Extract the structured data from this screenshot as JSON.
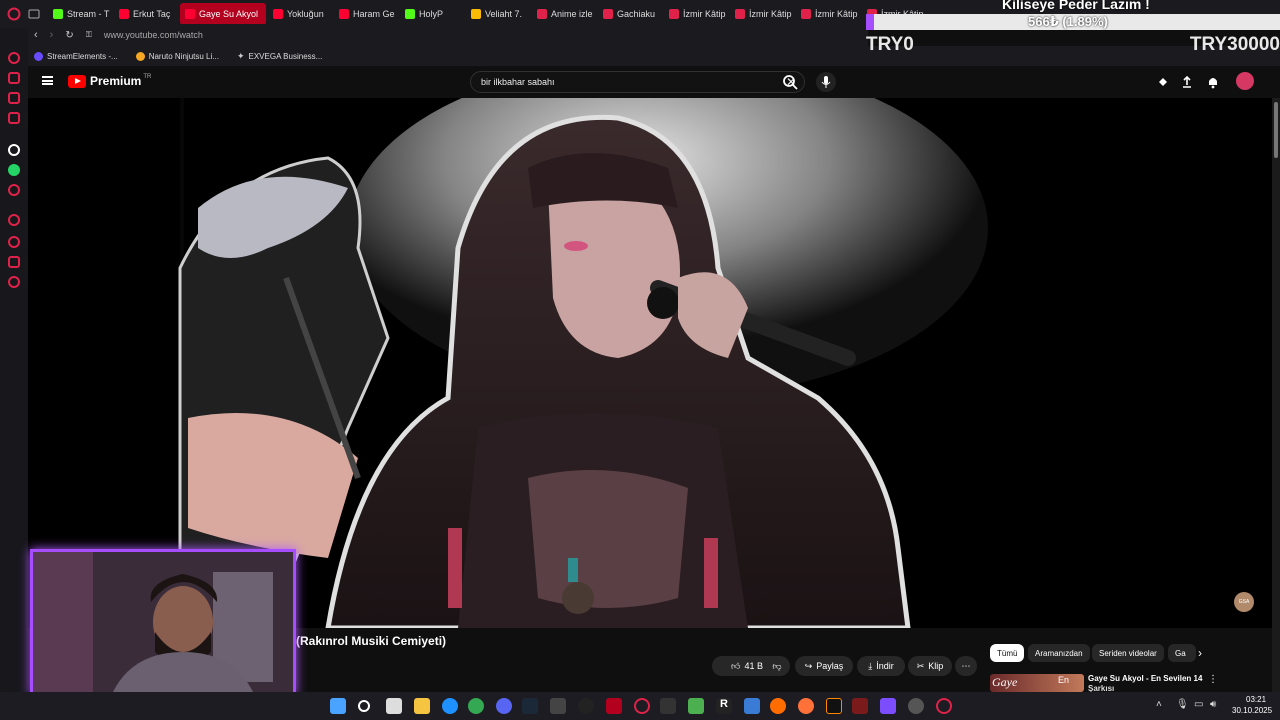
{
  "tabs": [
    {
      "label": "Stream - T",
      "color": "#53fc18"
    },
    {
      "label": "Erkut Taç",
      "color": "#ff0033"
    },
    {
      "label": "Gaye Su Akyol",
      "color": "#ff0033"
    },
    {
      "label": "Yokluğun",
      "color": "#ff0033"
    },
    {
      "label": "Haram Ge",
      "color": "#ff0033"
    },
    {
      "label": "HolyP",
      "color": "#53fc18"
    },
    {
      "label": "Veliaht 7.",
      "color": "#fbbc05"
    },
    {
      "label": "Anime izle",
      "color": "#e0224a"
    },
    {
      "label": "Gachiaku",
      "color": "#e0224a"
    },
    {
      "label": "İzmir Kâtip",
      "color": "#e0224a"
    },
    {
      "label": "İzmir Kâtip",
      "color": "#e0224a"
    },
    {
      "label": "İzmir Kâtip",
      "color": "#e0224a"
    },
    {
      "label": "İzmir Kâtip",
      "color": "#e0224a"
    }
  ],
  "address": {
    "url": "www.youtube.com/watch"
  },
  "bookmarks": [
    "StreamElements -...",
    "Naruto Ninjutsu Li...",
    "EXVEGA Business..."
  ],
  "stream_overlay": {
    "headline": "Kiliseye Peder Lazım !",
    "stat": "566₺ (1.89%)",
    "left_counter": "TRY0",
    "right_counter": "TRY30000"
  },
  "youtube": {
    "brand": "Premium",
    "region": "TR",
    "search_value": "bir ilkbahar sabahı"
  },
  "video": {
    "channel_badge": "GSA"
  },
  "below_video": {
    "title_fragment": "(Rakınrol Musiki Cemiyeti)",
    "like_count": "41 B",
    "share_label": "Paylaş",
    "download_label": "İndir",
    "clip_label": "Klip",
    "chips": [
      "Tümü",
      "Aramanızdan",
      "Seriden videolar",
      "Ga"
    ],
    "rec_thumb_text": "Gaye",
    "rec_thumb_text2": "En",
    "rec_title": "Gaye Su Akyol - En Sevilen 14",
    "rec_title2": "Şarkısı"
  },
  "taskbar": {
    "time": "03:21",
    "date": "30.10.2025"
  },
  "colors": {
    "accent": "#ff0033",
    "purple": "#a64dff",
    "bg": "#0f0f0f"
  }
}
